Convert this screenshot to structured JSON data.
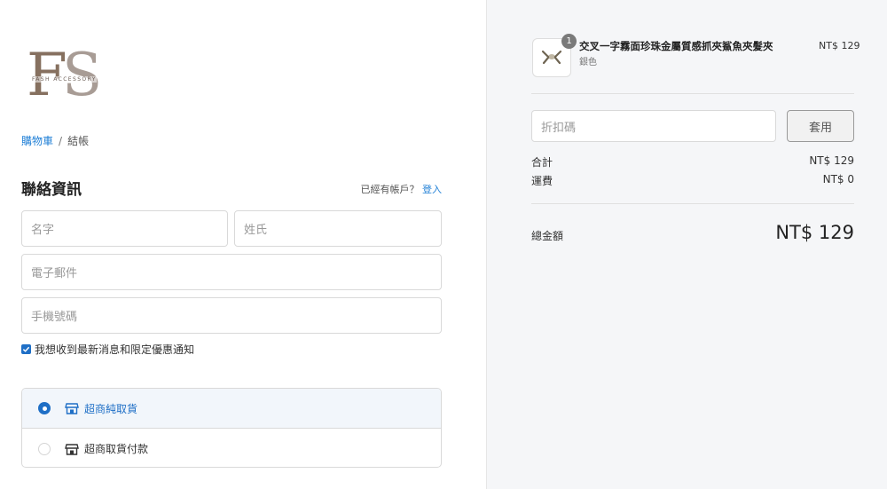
{
  "logo": {
    "letters_f": "F",
    "letters_s": "S",
    "text": "FASH ACCESSORY"
  },
  "breadcrumb": {
    "cart": "購物車",
    "separator": "/",
    "current": "結帳"
  },
  "contact": {
    "title": "聯絡資訊",
    "has_account_text": "已經有帳戶？",
    "login_link": "登入",
    "first_name_placeholder": "名字",
    "last_name_placeholder": "姓氏",
    "email_placeholder": "電子郵件",
    "phone_placeholder": "手機號碼",
    "newsletter_label": "我想收到最新消息和限定優惠通知",
    "newsletter_checked": true
  },
  "shipping": {
    "options": [
      {
        "label": "超商純取貨",
        "selected": true
      },
      {
        "label": "超商取貨付款",
        "selected": false
      }
    ]
  },
  "order": {
    "item": {
      "quantity": "1",
      "name": "交叉一字霧面珍珠金屬質感抓夾鯊魚夾髮夾",
      "variant": "銀色",
      "price": "NT$ 129"
    },
    "discount_placeholder": "折扣碼",
    "apply_label": "套用",
    "subtotal_label": "合計",
    "subtotal_value": "NT$ 129",
    "shipping_label": "運費",
    "shipping_value": "NT$ 0",
    "total_label": "總金額",
    "total_value": "NT$ 129"
  },
  "colors": {
    "accent": "#1f6fc6",
    "link": "#1f7fd6",
    "sidebar_bg": "#f5f6f8"
  }
}
